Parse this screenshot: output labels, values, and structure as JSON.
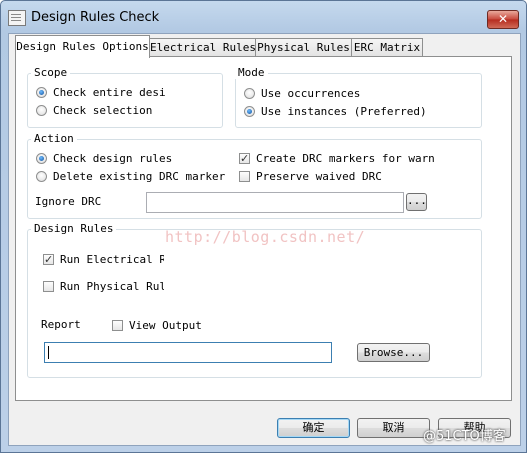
{
  "window": {
    "title": "Design Rules Check",
    "close_label": "✕"
  },
  "tabs": [
    {
      "label": "Design Rules Options",
      "active": true
    },
    {
      "label": "Electrical Rules",
      "active": false
    },
    {
      "label": "Physical Rules",
      "active": false
    },
    {
      "label": "ERC Matrix",
      "active": false
    }
  ],
  "scope": {
    "title": "Scope",
    "options": [
      {
        "label": "Check entire desigr",
        "checked": true
      },
      {
        "label": "Check selection",
        "checked": false
      }
    ]
  },
  "mode": {
    "title": "Mode",
    "options": [
      {
        "label": "Use occurrences",
        "checked": false
      },
      {
        "label": "Use instances (Preferred)",
        "checked": true
      }
    ]
  },
  "action": {
    "title": "Action",
    "radios": [
      {
        "label": "Check design rules",
        "checked": true
      },
      {
        "label": "Delete existing DRC marker",
        "checked": false
      }
    ],
    "checks": [
      {
        "label": "Create DRC markers for warn",
        "checked": true
      },
      {
        "label": "Preserve waived DRC",
        "checked": false
      }
    ],
    "ignore_label": "Ignore DRC",
    "ignore_value": "",
    "browse_small": "..."
  },
  "design_rules": {
    "title": "Design Rules",
    "checks": [
      {
        "label": "Run Electrical Ru",
        "checked": true
      },
      {
        "label": "Run Physical Rule",
        "checked": false
      }
    ],
    "report_label": "Report",
    "view_output_label": "View Output",
    "view_output_checked": false,
    "report_value": "",
    "browse_label": "Browse..."
  },
  "footer": {
    "ok_label": "确定",
    "cancel_label": "取消",
    "help_label": "帮助"
  },
  "watermark": "http://blog.csdn.net/",
  "corner_mark": "@51CTO博客",
  "colors": {
    "accent": "#3c7fb1",
    "titlebar": "#c5d9ee",
    "close": "#c7463a"
  }
}
